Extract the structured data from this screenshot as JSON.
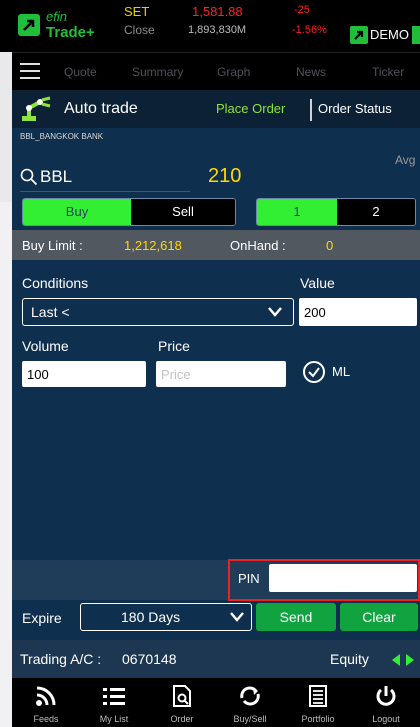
{
  "header": {
    "logo_efin": "efin",
    "logo_trade": "Trade+",
    "set_label": "SET",
    "close_label": "Close",
    "index_value": "1,581.88",
    "volume": "1,893,830M",
    "change": "-25",
    "change_pct": "-1.56%",
    "mode_label": "DEMO"
  },
  "nav": [
    "Quote",
    "Summary",
    "Graph",
    "News",
    "Ticker"
  ],
  "titlebar": {
    "title": "Auto trade",
    "place_order": "Place Order",
    "order_status": "Order Status"
  },
  "stock": {
    "full_name": "BBL_BANGKOK BANK",
    "symbol": "BBL",
    "price": "210",
    "avg_label": "Avg"
  },
  "side": {
    "buy": "Buy",
    "sell": "Sell"
  },
  "account_toggle": {
    "one": "1",
    "two": "2"
  },
  "info": {
    "buy_limit_label": "Buy Limit :",
    "buy_limit_value": "1,212,618",
    "onhand_label": "OnHand :",
    "onhand_value": "0"
  },
  "form": {
    "conditions_label": "Conditions",
    "condition_value": "Last <",
    "value_label": "Value",
    "value_input": "200",
    "volume_label": "Volume",
    "volume_input": "100",
    "price_label": "Price",
    "price_placeholder": "Price",
    "ml_label": "ML"
  },
  "pin": {
    "label": "PIN"
  },
  "expire": {
    "label": "Expire",
    "value": "180 Days",
    "send": "Send",
    "clear": "Clear"
  },
  "account": {
    "label": "Trading A/C :",
    "number": "0670148",
    "type": "Equity"
  },
  "tabs": [
    "Feeds",
    "My List",
    "Order",
    "Buy/Sell",
    "Portfolio",
    "Logout"
  ],
  "colors": {
    "accent_green": "#33ef33",
    "price_yellow": "#ffd800",
    "down_red": "#ff2020",
    "panel_navy": "#0f2f4f",
    "button_green": "#12a341"
  }
}
